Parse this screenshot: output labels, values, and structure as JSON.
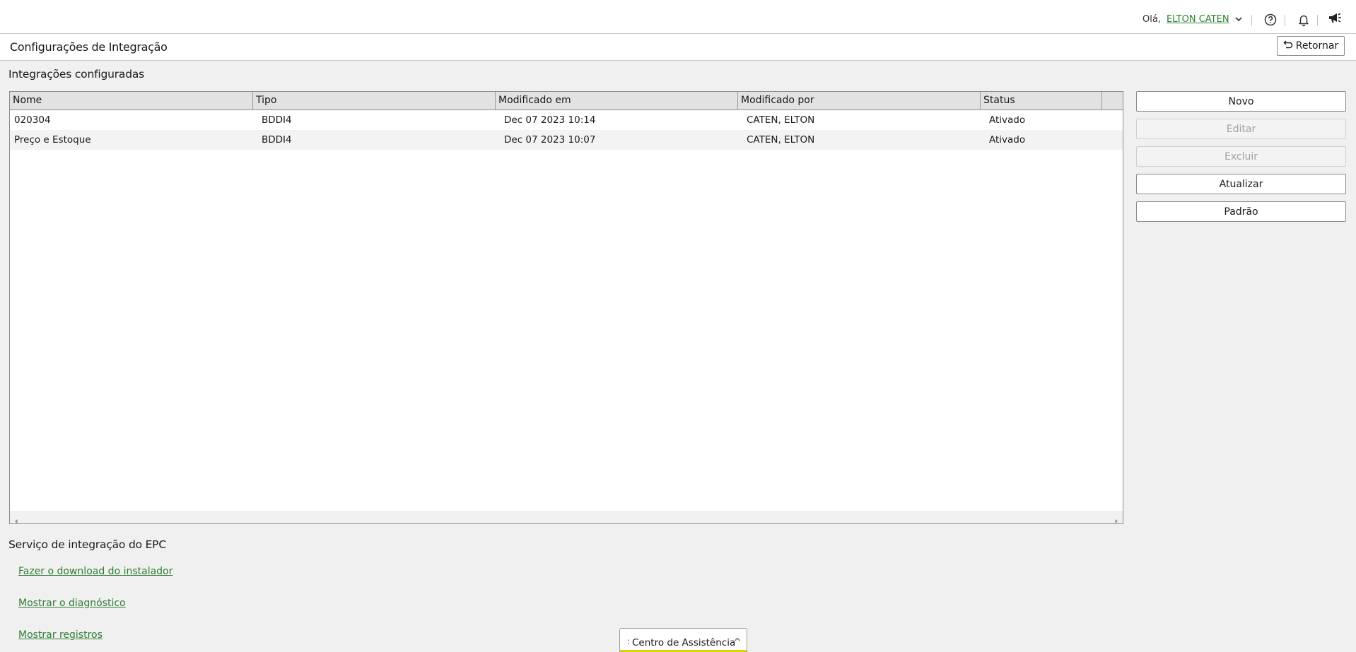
{
  "header": {
    "greeting": "Olá,",
    "user_name": "ELTON CATEN",
    "icons": [
      "chevron-down-icon",
      "help-icon",
      "bell-icon",
      "megaphone-icon"
    ]
  },
  "page": {
    "title": "Configurações de Integração",
    "return_label": "Retornar"
  },
  "integrations": {
    "section_title": "Integrações configuradas",
    "columns": [
      "Nome",
      "Tipo",
      "Modificado em",
      "Modificado por",
      "Status"
    ],
    "rows": [
      {
        "name": "020304",
        "type": "BDDI4",
        "modified_at": "Dec 07 2023 10:14",
        "modified_by": "CATEN, ELTON",
        "status": "Ativado"
      },
      {
        "name": "Preço e Estoque",
        "type": "BDDI4",
        "modified_at": "Dec 07 2023 10:07",
        "modified_by": "CATEN, ELTON",
        "status": "Ativado"
      }
    ]
  },
  "actions": {
    "new": "Novo",
    "edit": "Editar",
    "delete": "Excluir",
    "refresh": "Atualizar",
    "default": "Padrão"
  },
  "service": {
    "section_title": "Serviço de integração do EPC",
    "links": [
      "Fazer o download do instalador",
      "Mostrar o diagnóstico",
      "Mostrar registros"
    ]
  },
  "assist": {
    "label": "Centro de Assistência"
  },
  "colors": {
    "link": "#2e7d32",
    "assist_accent": "#e6d200"
  }
}
